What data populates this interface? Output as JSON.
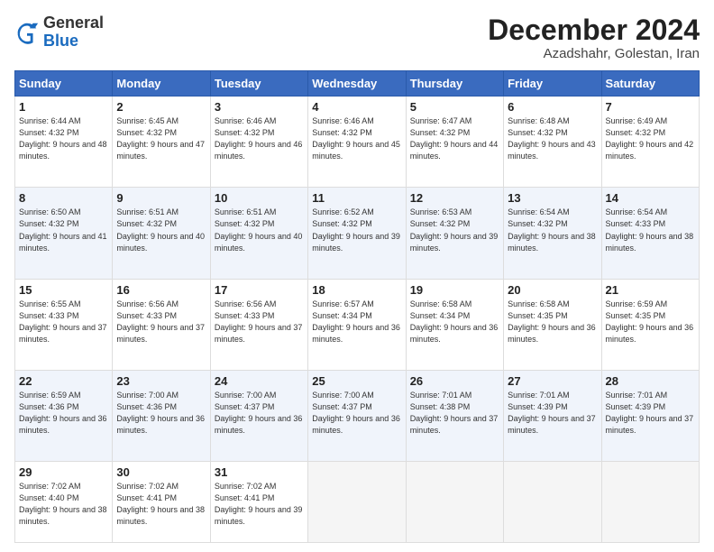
{
  "logo": {
    "general": "General",
    "blue": "Blue"
  },
  "header": {
    "month": "December 2024",
    "location": "Azadshahr, Golestan, Iran"
  },
  "weekdays": [
    "Sunday",
    "Monday",
    "Tuesday",
    "Wednesday",
    "Thursday",
    "Friday",
    "Saturday"
  ],
  "weeks": [
    [
      {
        "day": "1",
        "sunrise": "6:44 AM",
        "sunset": "4:32 PM",
        "daylight": "9 hours and 48 minutes."
      },
      {
        "day": "2",
        "sunrise": "6:45 AM",
        "sunset": "4:32 PM",
        "daylight": "9 hours and 47 minutes."
      },
      {
        "day": "3",
        "sunrise": "6:46 AM",
        "sunset": "4:32 PM",
        "daylight": "9 hours and 46 minutes."
      },
      {
        "day": "4",
        "sunrise": "6:46 AM",
        "sunset": "4:32 PM",
        "daylight": "9 hours and 45 minutes."
      },
      {
        "day": "5",
        "sunrise": "6:47 AM",
        "sunset": "4:32 PM",
        "daylight": "9 hours and 44 minutes."
      },
      {
        "day": "6",
        "sunrise": "6:48 AM",
        "sunset": "4:32 PM",
        "daylight": "9 hours and 43 minutes."
      },
      {
        "day": "7",
        "sunrise": "6:49 AM",
        "sunset": "4:32 PM",
        "daylight": "9 hours and 42 minutes."
      }
    ],
    [
      {
        "day": "8",
        "sunrise": "6:50 AM",
        "sunset": "4:32 PM",
        "daylight": "9 hours and 41 minutes."
      },
      {
        "day": "9",
        "sunrise": "6:51 AM",
        "sunset": "4:32 PM",
        "daylight": "9 hours and 40 minutes."
      },
      {
        "day": "10",
        "sunrise": "6:51 AM",
        "sunset": "4:32 PM",
        "daylight": "9 hours and 40 minutes."
      },
      {
        "day": "11",
        "sunrise": "6:52 AM",
        "sunset": "4:32 PM",
        "daylight": "9 hours and 39 minutes."
      },
      {
        "day": "12",
        "sunrise": "6:53 AM",
        "sunset": "4:32 PM",
        "daylight": "9 hours and 39 minutes."
      },
      {
        "day": "13",
        "sunrise": "6:54 AM",
        "sunset": "4:32 PM",
        "daylight": "9 hours and 38 minutes."
      },
      {
        "day": "14",
        "sunrise": "6:54 AM",
        "sunset": "4:33 PM",
        "daylight": "9 hours and 38 minutes."
      }
    ],
    [
      {
        "day": "15",
        "sunrise": "6:55 AM",
        "sunset": "4:33 PM",
        "daylight": "9 hours and 37 minutes."
      },
      {
        "day": "16",
        "sunrise": "6:56 AM",
        "sunset": "4:33 PM",
        "daylight": "9 hours and 37 minutes."
      },
      {
        "day": "17",
        "sunrise": "6:56 AM",
        "sunset": "4:33 PM",
        "daylight": "9 hours and 37 minutes."
      },
      {
        "day": "18",
        "sunrise": "6:57 AM",
        "sunset": "4:34 PM",
        "daylight": "9 hours and 36 minutes."
      },
      {
        "day": "19",
        "sunrise": "6:58 AM",
        "sunset": "4:34 PM",
        "daylight": "9 hours and 36 minutes."
      },
      {
        "day": "20",
        "sunrise": "6:58 AM",
        "sunset": "4:35 PM",
        "daylight": "9 hours and 36 minutes."
      },
      {
        "day": "21",
        "sunrise": "6:59 AM",
        "sunset": "4:35 PM",
        "daylight": "9 hours and 36 minutes."
      }
    ],
    [
      {
        "day": "22",
        "sunrise": "6:59 AM",
        "sunset": "4:36 PM",
        "daylight": "9 hours and 36 minutes."
      },
      {
        "day": "23",
        "sunrise": "7:00 AM",
        "sunset": "4:36 PM",
        "daylight": "9 hours and 36 minutes."
      },
      {
        "day": "24",
        "sunrise": "7:00 AM",
        "sunset": "4:37 PM",
        "daylight": "9 hours and 36 minutes."
      },
      {
        "day": "25",
        "sunrise": "7:00 AM",
        "sunset": "4:37 PM",
        "daylight": "9 hours and 36 minutes."
      },
      {
        "day": "26",
        "sunrise": "7:01 AM",
        "sunset": "4:38 PM",
        "daylight": "9 hours and 37 minutes."
      },
      {
        "day": "27",
        "sunrise": "7:01 AM",
        "sunset": "4:39 PM",
        "daylight": "9 hours and 37 minutes."
      },
      {
        "day": "28",
        "sunrise": "7:01 AM",
        "sunset": "4:39 PM",
        "daylight": "9 hours and 37 minutes."
      }
    ],
    [
      {
        "day": "29",
        "sunrise": "7:02 AM",
        "sunset": "4:40 PM",
        "daylight": "9 hours and 38 minutes."
      },
      {
        "day": "30",
        "sunrise": "7:02 AM",
        "sunset": "4:41 PM",
        "daylight": "9 hours and 38 minutes."
      },
      {
        "day": "31",
        "sunrise": "7:02 AM",
        "sunset": "4:41 PM",
        "daylight": "9 hours and 39 minutes."
      },
      null,
      null,
      null,
      null
    ]
  ]
}
